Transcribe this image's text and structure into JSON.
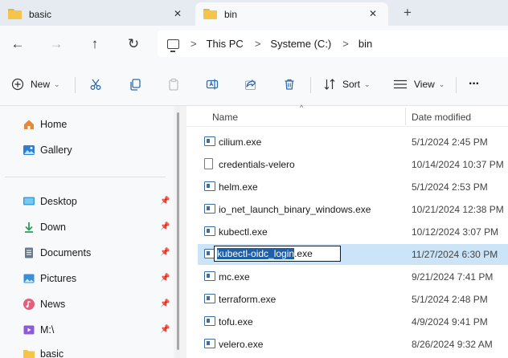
{
  "tabs": [
    {
      "label": "basic",
      "active": false
    },
    {
      "label": "bin",
      "active": true
    }
  ],
  "tab_close_glyph": "✕",
  "new_tab_glyph": "+",
  "nav": {
    "back": "←",
    "forward": "→",
    "up": "↑",
    "refresh": "↻"
  },
  "breadcrumb": [
    "This PC",
    "Systeme (C:)",
    "bin"
  ],
  "breadcrumb_sep": ">",
  "commands": {
    "new_label": "New",
    "sort_label": "Sort",
    "view_label": "View",
    "more": "···"
  },
  "sidebar": {
    "items": [
      {
        "label": "Home",
        "icon": "home-icon",
        "pinned": false
      },
      {
        "label": "Gallery",
        "icon": "gallery-icon",
        "pinned": false
      },
      {
        "label": "Desktop",
        "icon": "desktop-icon",
        "pinned": true
      },
      {
        "label": "Down",
        "icon": "download-icon",
        "pinned": true
      },
      {
        "label": "Documents",
        "icon": "documents-icon",
        "pinned": true
      },
      {
        "label": "Pictures",
        "icon": "pictures-icon",
        "pinned": true
      },
      {
        "label": "News",
        "icon": "music-icon",
        "pinned": true
      },
      {
        "label": "M:\\",
        "icon": "video-icon",
        "pinned": true
      },
      {
        "label": "basic",
        "icon": "folder-icon",
        "pinned": false
      }
    ]
  },
  "columns": {
    "name": "Name",
    "date": "Date modified"
  },
  "files": [
    {
      "name": "cilium.exe",
      "date": "5/1/2024 2:45 PM",
      "type": "exe"
    },
    {
      "name": "credentials-velero",
      "date": "10/14/2024 10:37 PM",
      "type": "doc"
    },
    {
      "name": "helm.exe",
      "date": "5/1/2024 2:53 PM",
      "type": "exe"
    },
    {
      "name": "io_net_launch_binary_windows.exe",
      "date": "10/21/2024 12:38 PM",
      "type": "exe"
    },
    {
      "name": "kubectl.exe",
      "date": "10/12/2024 3:07 PM",
      "type": "exe"
    },
    {
      "name": "kubectl-oidc_login.exe",
      "date": "11/27/2024 6:30 PM",
      "type": "exe",
      "renaming": true
    },
    {
      "name": "mc.exe",
      "date": "9/21/2024 7:41 PM",
      "type": "exe"
    },
    {
      "name": "terraform.exe",
      "date": "5/1/2024 2:48 PM",
      "type": "exe"
    },
    {
      "name": "tofu.exe",
      "date": "4/9/2024 9:41 PM",
      "type": "exe"
    },
    {
      "name": "velero.exe",
      "date": "8/26/2024 9:32 AM",
      "type": "exe"
    }
  ],
  "rename": {
    "selected_part": "kubectl-oidc_login",
    "rest": ".exe"
  },
  "colors": {
    "accent": "#1f5fa8",
    "selection": "#cce4f7",
    "folder": "#f5c44a"
  }
}
